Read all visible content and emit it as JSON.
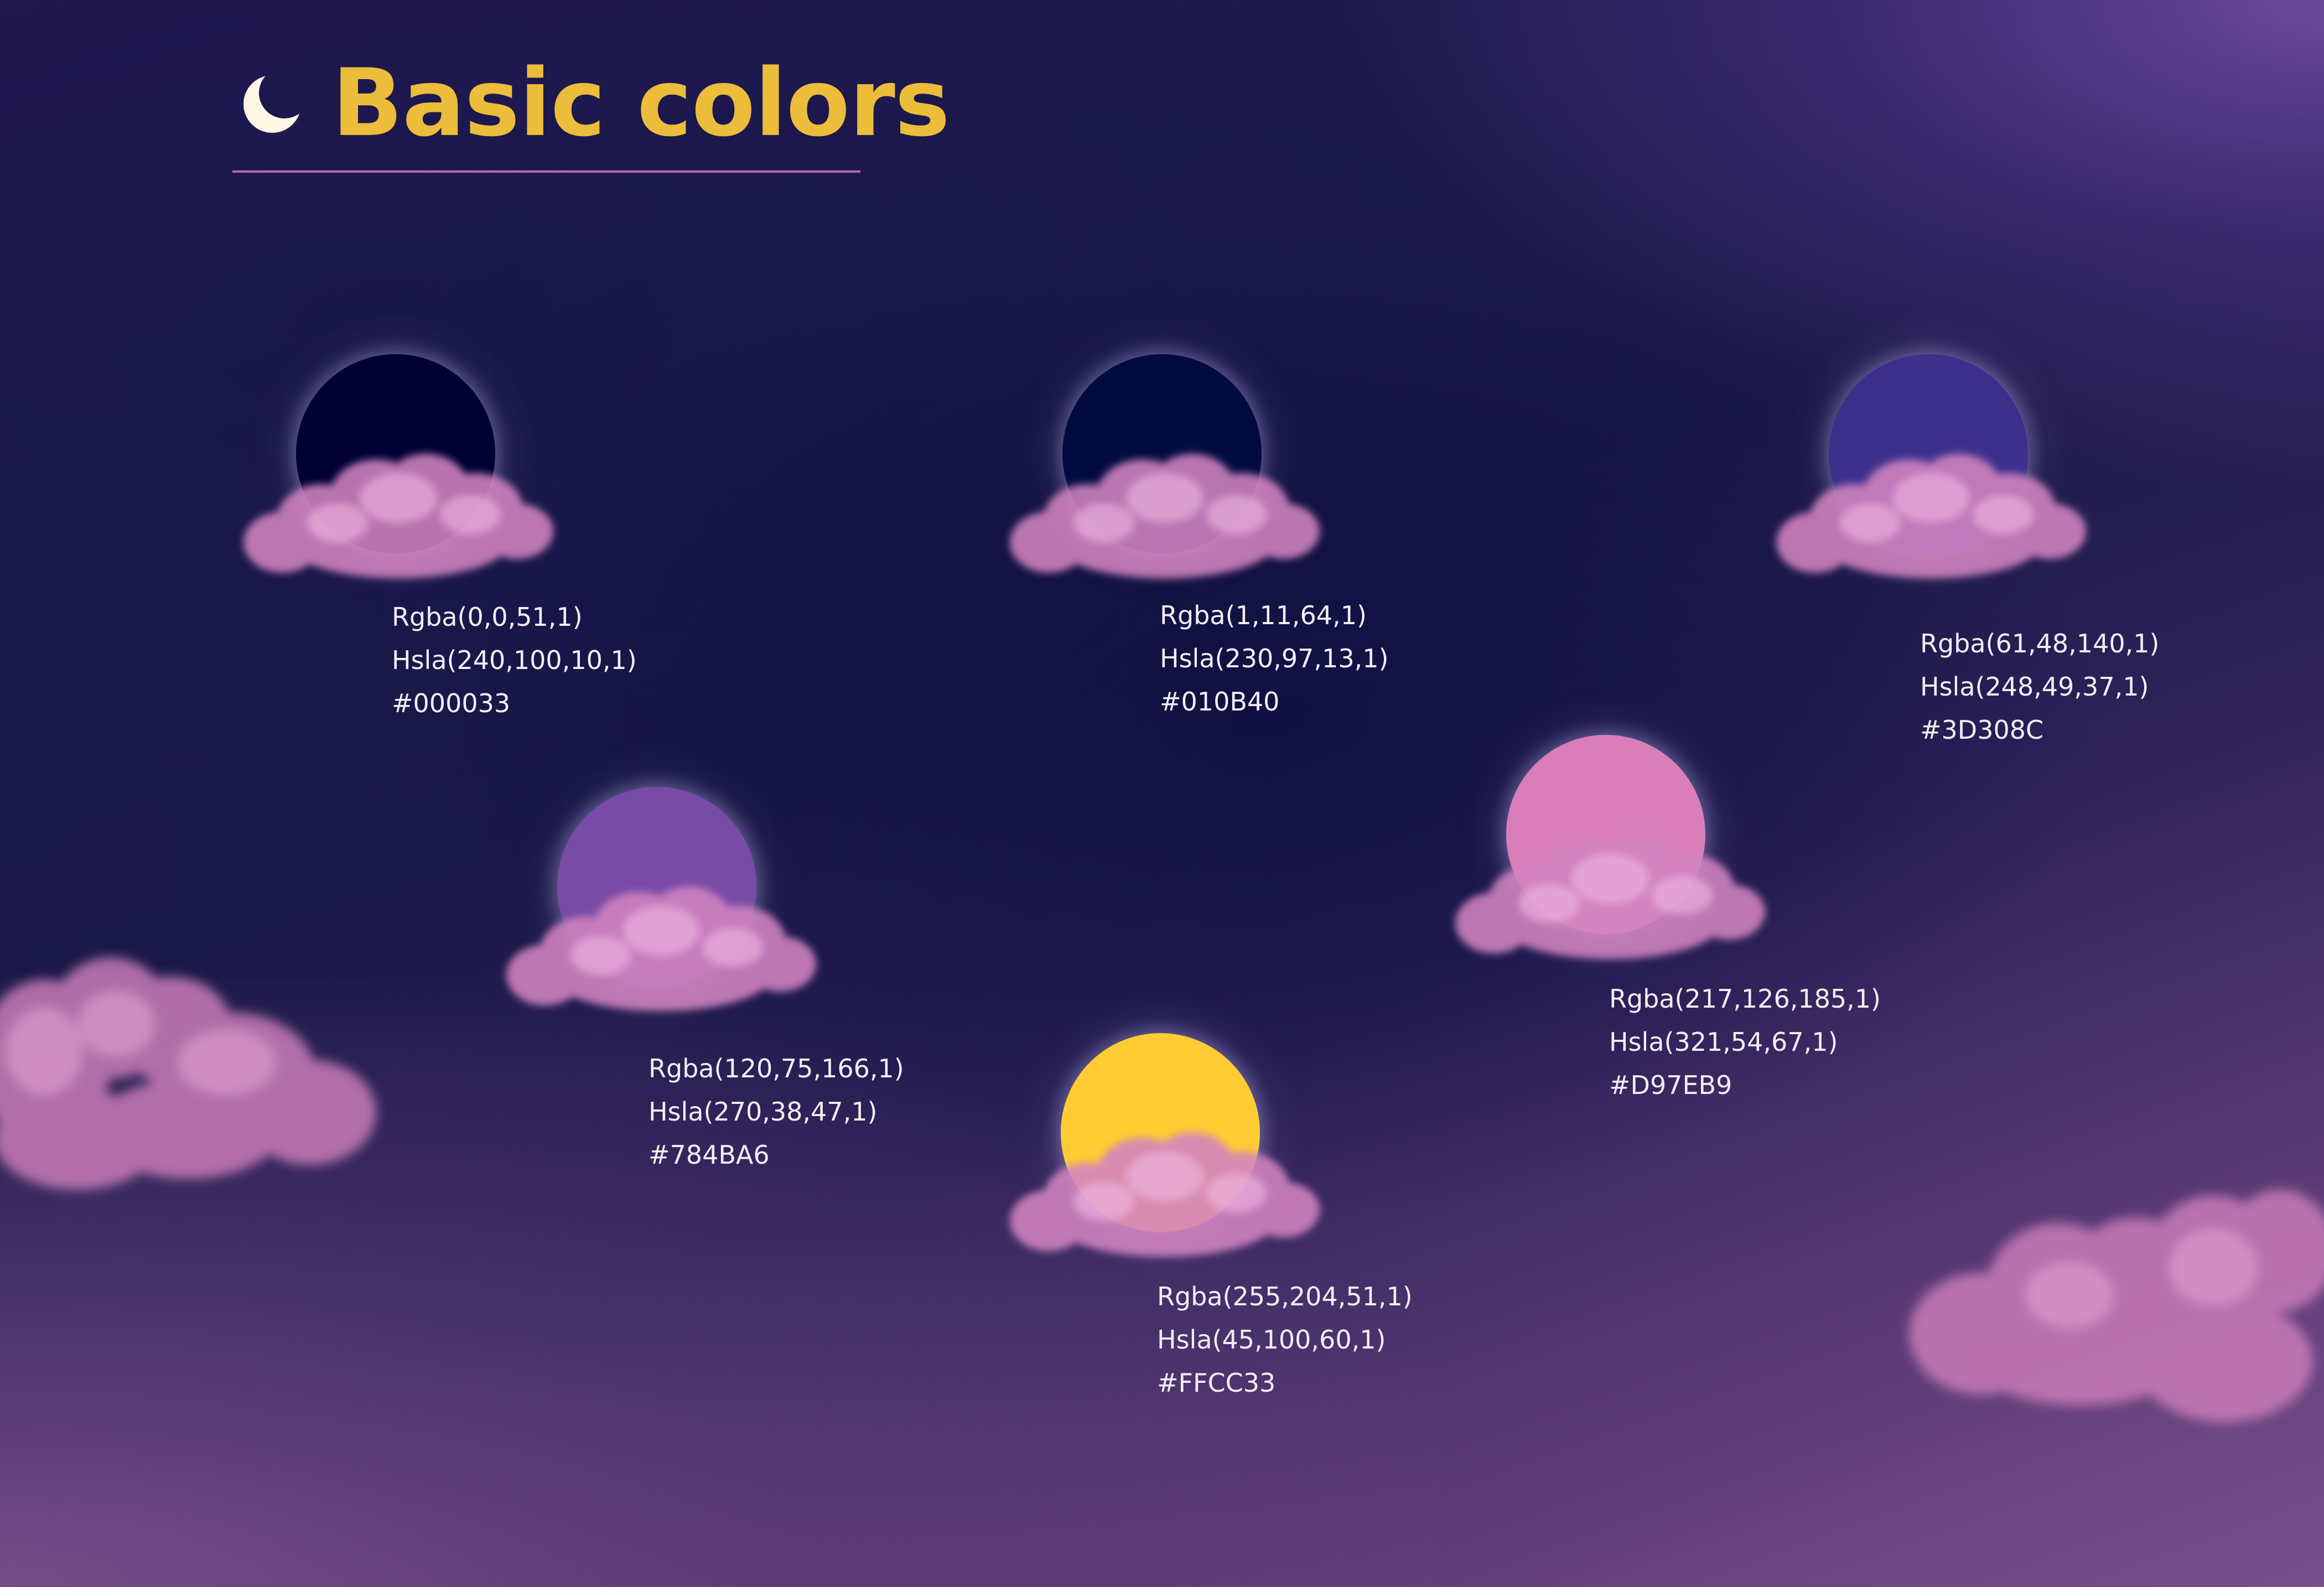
{
  "header": {
    "title": "Basic colors",
    "icon": "crescent-moon-icon",
    "title_color": "#ebbd3a",
    "divider_color": "#b56aa8"
  },
  "swatches": [
    {
      "rgba": "Rgba(0,0,51,1)",
      "hsla": "Hsla(240,100,10,1)",
      "hex": "#000033",
      "color": "#000033"
    },
    {
      "rgba": "Rgba(1,11,64,1)",
      "hsla": "Hsla(230,97,13,1)",
      "hex": "#010B40",
      "color": "#010B40"
    },
    {
      "rgba": "Rgba(61,48,140,1)",
      "hsla": "Hsla(248,49,37,1)",
      "hex": "#3D308C",
      "color": "#3D308C"
    },
    {
      "rgba": "Rgba(120,75,166,1)",
      "hsla": "Hsla(270,38,47,1)",
      "hex": "#784BA6",
      "color": "#784BA6"
    },
    {
      "rgba": "Rgba(217,126,185,1)",
      "hsla": "Hsla(321,54,67,1)",
      "hex": "#D97EB9",
      "color": "#D97EB9"
    },
    {
      "rgba": "Rgba(255,204,51,1)",
      "hsla": "Hsla(45,100,60,1)",
      "hex": "#FFCC33",
      "color": "#FFCC33"
    }
  ],
  "decoration": {
    "cloud_color": "#d88ec4"
  }
}
